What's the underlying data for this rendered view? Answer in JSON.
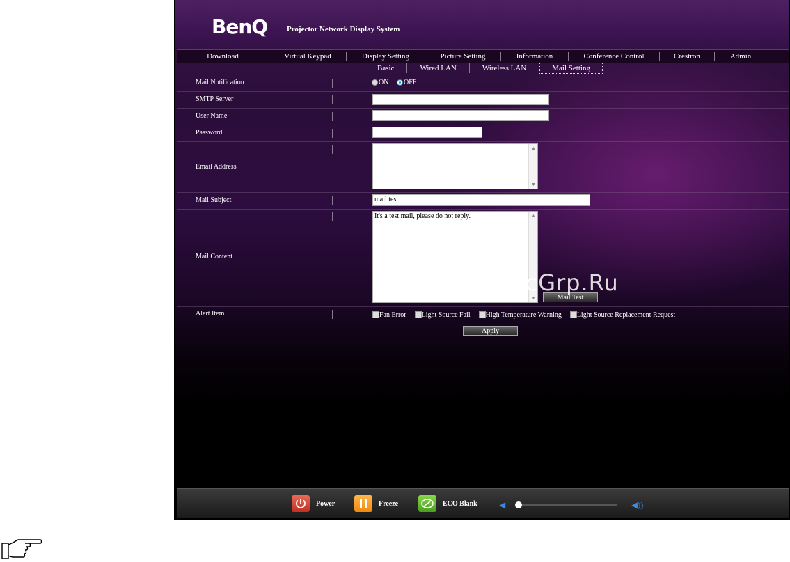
{
  "header": {
    "logo": "BenQ",
    "title": "Projector Network Display System"
  },
  "nav": {
    "tabs": [
      "Download",
      "Virtual Keypad",
      "Display Setting",
      "Picture Setting",
      "Information",
      "Conference Control",
      "Crestron",
      "Admin"
    ]
  },
  "subnav": {
    "tabs": [
      "Basic",
      "Wired LAN",
      "Wireless LAN",
      "Mail Setting"
    ],
    "active": "Mail Setting"
  },
  "form": {
    "mail_notification": {
      "label": "Mail Notification",
      "on_label": "ON",
      "off_label": "OFF",
      "selected": "OFF"
    },
    "smtp_server": {
      "label": "SMTP Server",
      "value": ""
    },
    "user_name": {
      "label": "User Name",
      "value": ""
    },
    "password": {
      "label": "Password",
      "value": ""
    },
    "email_address": {
      "label": "Email Address",
      "value": ""
    },
    "mail_subject": {
      "label": "Mail Subject",
      "value": "mail test"
    },
    "mail_content": {
      "label": "Mail Content",
      "value": "It's a test mail, please do not reply."
    },
    "mail_test_label": "Mail Test",
    "alert_item": {
      "label": "Alert Item",
      "options": [
        "Fan Error",
        "Light Source Fail",
        "High Temperature Warning",
        "Light Source Replacement Request"
      ]
    },
    "apply_label": "Apply"
  },
  "footer": {
    "power": "Power",
    "freeze": "Freeze",
    "eco_blank": "ECO Blank",
    "volume_level": 0
  },
  "watermark": "McGrp.Ru"
}
